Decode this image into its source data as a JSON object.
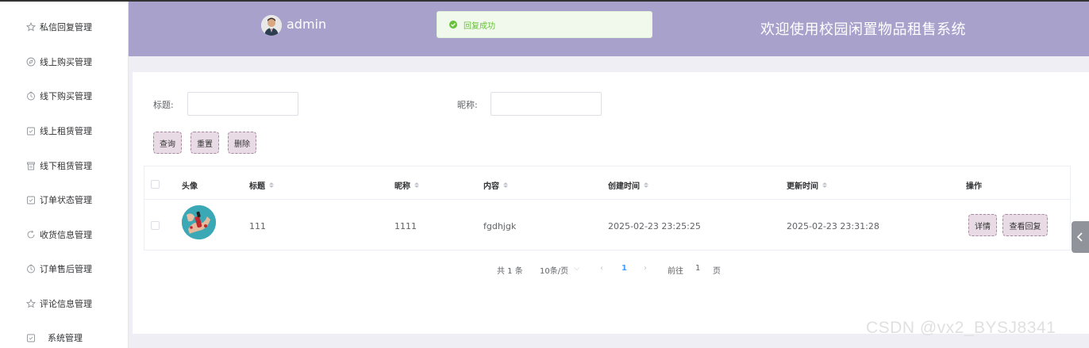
{
  "sidebar": {
    "items": [
      {
        "label": "私信回复管理",
        "icon": "star-icon"
      },
      {
        "label": "线上购买管理",
        "icon": "compass-icon"
      },
      {
        "label": "线下购买管理",
        "icon": "clock-icon"
      },
      {
        "label": "线上租赁管理",
        "icon": "calendar-check-icon"
      },
      {
        "label": "线下租赁管理",
        "icon": "trash-icon"
      },
      {
        "label": "订单状态管理",
        "icon": "calendar-check-icon"
      },
      {
        "label": "收货信息管理",
        "icon": "refresh-icon"
      },
      {
        "label": "订单售后管理",
        "icon": "clock-icon"
      },
      {
        "label": "评论信息管理",
        "icon": "star-icon"
      },
      {
        "label": "系统管理",
        "icon": "calendar-check-icon"
      }
    ]
  },
  "header": {
    "username": "admin",
    "welcome": "欢迎使用校园闲置物品租售系统",
    "bg_color": "#a8a1cc"
  },
  "toast": {
    "message": "回复成功",
    "color": "#67c23a"
  },
  "filters": {
    "title_label": "标题:",
    "title_value": "",
    "nickname_label": "昵称:",
    "nickname_value": ""
  },
  "buttons": {
    "query": "查询",
    "reset": "重置",
    "delete": "删除"
  },
  "table": {
    "columns": [
      "头像",
      "标题",
      "昵称",
      "内容",
      "创建时间",
      "更新时间",
      "操作"
    ],
    "rows": [
      {
        "title": "111",
        "nickname": "1111",
        "content": "fgdhjgk",
        "created": "2025-02-23 23:25:25",
        "updated": "2025-02-23 23:31:28",
        "actions": [
          "详情",
          "查看回复"
        ]
      }
    ]
  },
  "pagination": {
    "total": "共 1 条",
    "page_size": "10条/页",
    "current_page": "1",
    "goto_label": "前往",
    "goto_value": "1",
    "page_suffix": "页"
  },
  "watermark": "CSDN @vx2_BYSJ8341"
}
